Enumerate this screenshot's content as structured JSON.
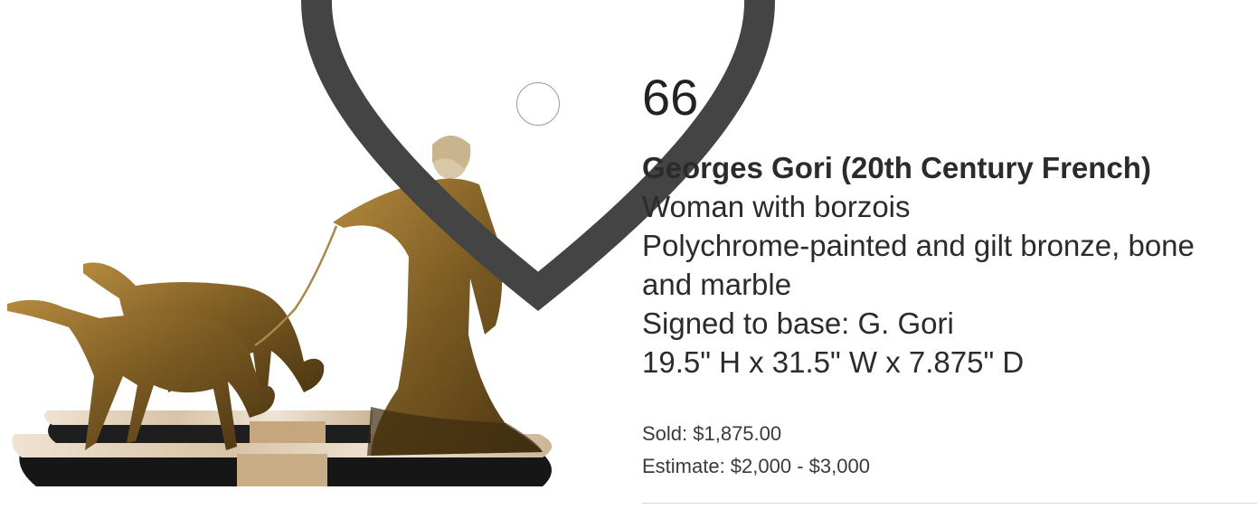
{
  "lot": {
    "number": "66",
    "artist": "Georges Gori (20th Century French)",
    "description_lines": [
      "Woman with borzois",
      "Polychrome-painted and gilt bronze, bone",
      "and marble",
      "Signed to base: G. Gori",
      "19.5\" H x 31.5\" W x 7.875\" D"
    ],
    "sold": "Sold: $1,875.00",
    "estimate": "Estimate: $2,000 - $3,000"
  },
  "icons": {
    "favorite": "heart-icon"
  },
  "colors": {
    "bronze": "#8a6a2c",
    "marble_light": "#e6d8c4",
    "marble_dark": "#1a1a1a",
    "divider": "#d8d8d8"
  }
}
